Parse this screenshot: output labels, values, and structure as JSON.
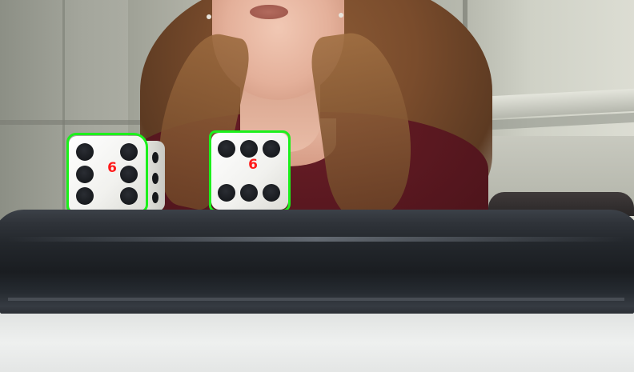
{
  "scene": {
    "description_tags": [
      "dice",
      "person",
      "tube",
      "table"
    ],
    "detection_color": "#1cf01c",
    "label_color": "#ff1a1a"
  },
  "dice": [
    {
      "label": "6",
      "pips": 6
    },
    {
      "label": "6",
      "pips": 6
    }
  ]
}
